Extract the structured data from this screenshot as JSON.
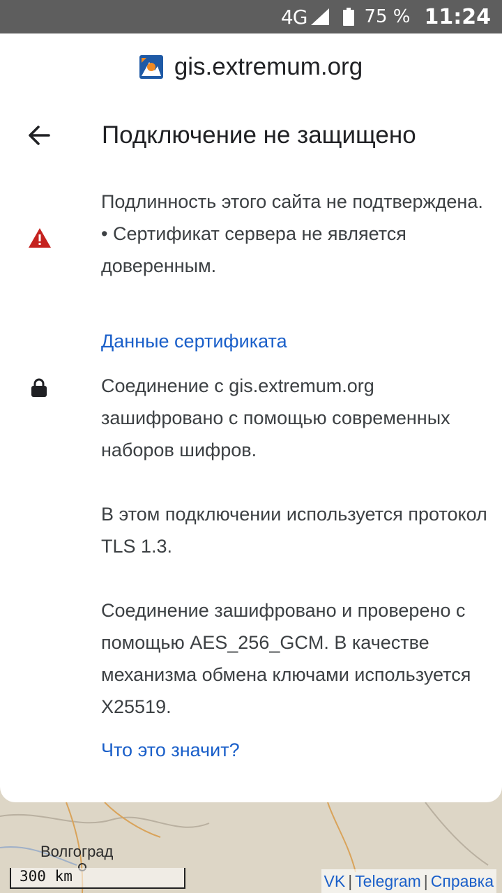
{
  "status_bar": {
    "network": "4G",
    "battery": "75 %",
    "time": "11:24"
  },
  "site": {
    "domain": "gis.extremum.org"
  },
  "dialog": {
    "title": "Подключение не защищено",
    "identity": {
      "line1": "Подлинность этого сайта не подтверждена.",
      "line2": "• Сертификат сервера не является доверенным.",
      "link": "Данные сертификата"
    },
    "connection": {
      "para1": "Соединение с gis.extremum.org зашифровано с помощью современных наборов шифров.",
      "para2": "В этом подключении используется протокол TLS 1.3.",
      "para3": "Соединение зашифровано и проверено с помощью AES_256_GCM. В качестве механизма обмена ключами используется X25519.",
      "link": "Что это значит?"
    }
  },
  "map": {
    "city": "Волгоград",
    "scale": "300 km",
    "links": [
      "VK",
      "Telegram",
      "Справка"
    ]
  },
  "colors": {
    "link": "#1a5fc9",
    "warning": "#c5221f",
    "status_bar": "#5e5e5e"
  },
  "icons": [
    "site-favicon",
    "back-arrow-icon",
    "warning-icon",
    "lock-icon",
    "signal-icon",
    "battery-icon"
  ]
}
